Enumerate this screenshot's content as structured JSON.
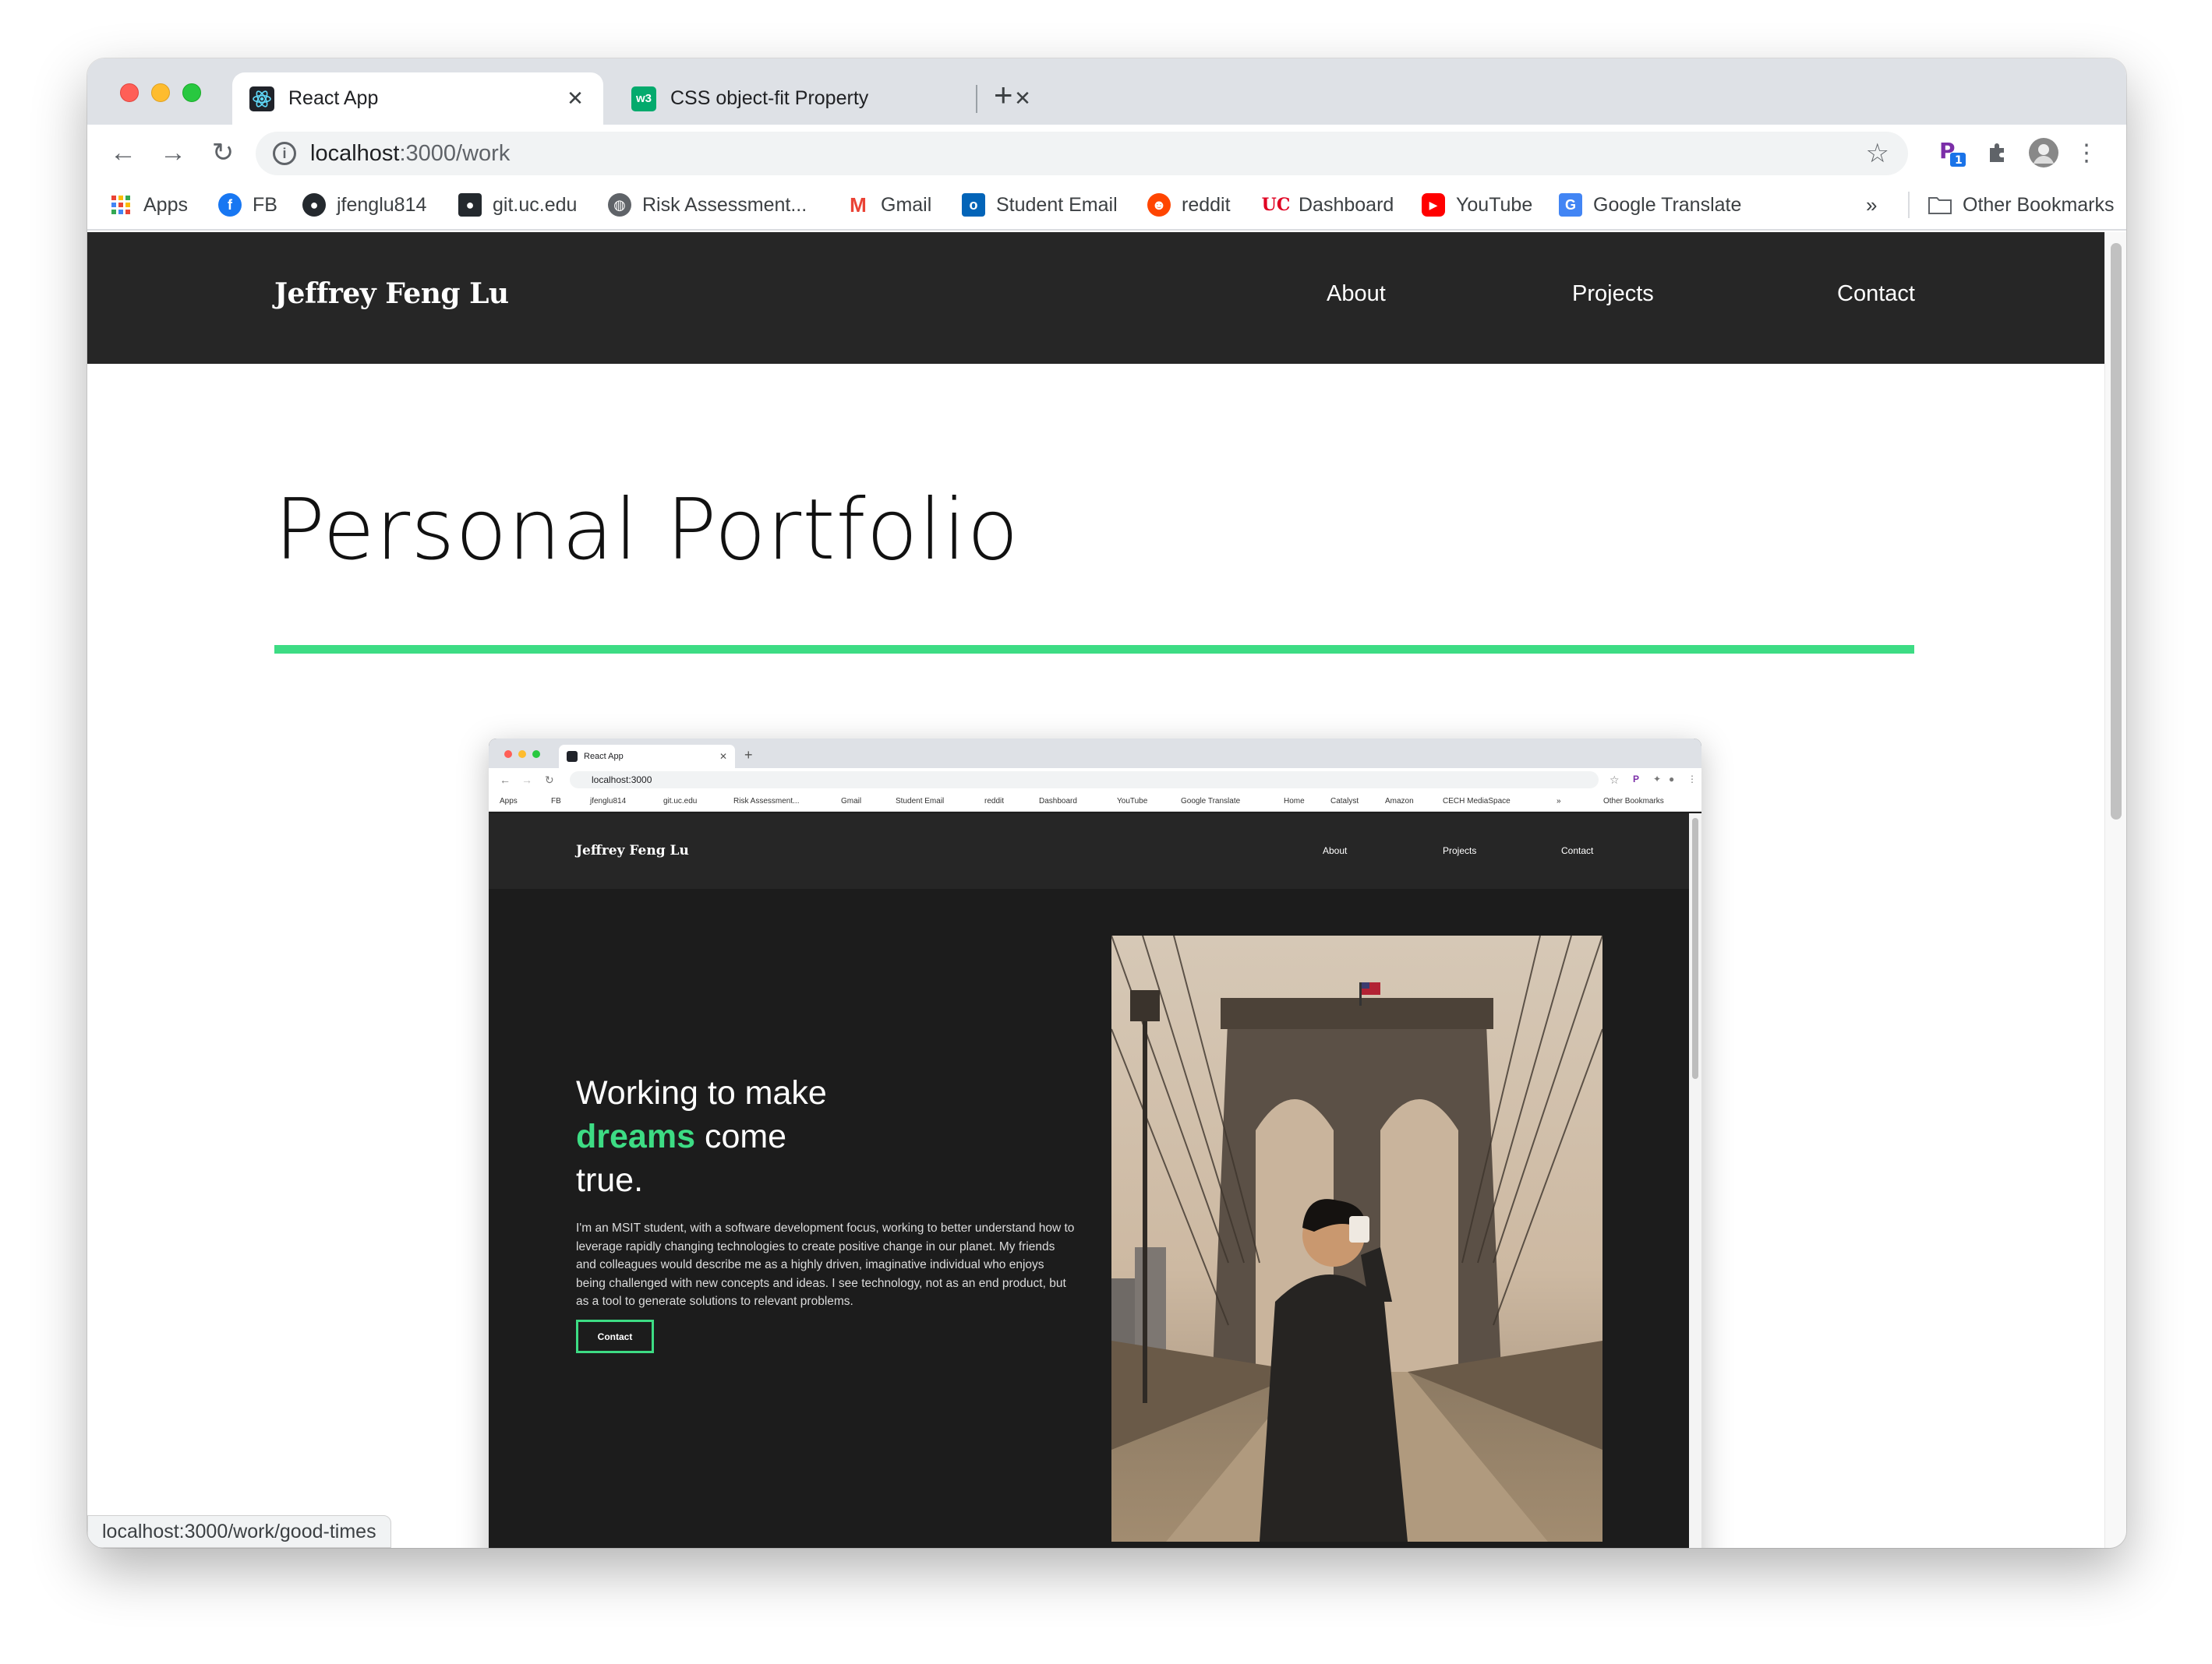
{
  "browser": {
    "tabs": [
      {
        "label": "React App",
        "active": true,
        "icon": "react-icon"
      },
      {
        "label": "CSS object-fit Property",
        "active": false,
        "icon": "w3schools-icon"
      }
    ],
    "url_host": "localhost",
    "url_path": ":3000/work",
    "bookmarks": [
      {
        "label": "Apps",
        "icon": "apps-grid-icon"
      },
      {
        "label": "FB",
        "icon": "facebook-icon"
      },
      {
        "label": "jfenglu814",
        "icon": "github-icon"
      },
      {
        "label": "git.uc.edu",
        "icon": "github-icon"
      },
      {
        "label": "Risk Assessment...",
        "icon": "globe-icon"
      },
      {
        "label": "Gmail",
        "icon": "gmail-icon"
      },
      {
        "label": "Student Email",
        "icon": "outlook-icon"
      },
      {
        "label": "reddit",
        "icon": "reddit-icon"
      },
      {
        "label": "Dashboard",
        "icon": "uc-icon"
      },
      {
        "label": "YouTube",
        "icon": "youtube-icon"
      },
      {
        "label": "Google Translate",
        "icon": "google-translate-icon"
      }
    ],
    "overflow_label": "»",
    "other_bookmarks": "Other Bookmarks",
    "status_url": "localhost:3000/work/good-times"
  },
  "site": {
    "brand": "Jeffrey Feng Lu",
    "nav": [
      "About",
      "Projects",
      "Contact"
    ],
    "page_title": "Personal Portfolio",
    "accent_color": "#3ddc84"
  },
  "preview": {
    "tab_label": "React App",
    "url": "localhost:3000",
    "bookmarks": [
      "Apps",
      "FB",
      "jfenglu814",
      "git.uc.edu",
      "Risk Assessment...",
      "Gmail",
      "Student Email",
      "reddit",
      "Dashboard",
      "YouTube",
      "Google Translate",
      "Home",
      "Catalyst",
      "Amazon",
      "CECH MediaSpace"
    ],
    "other_bookmarks": "Other Bookmarks",
    "brand": "Jeffrey Feng Lu",
    "nav": [
      "About",
      "Projects",
      "Contact"
    ],
    "headline_pre": "Working to make",
    "headline_accent": "dreams",
    "headline_mid": "come",
    "headline_post": "true.",
    "body": "I'm an MSIT student, with a software development focus, working to better understand how to leverage rapidly changing technologies to create positive change in our planet. My friends and colleagues would describe me as a highly driven, imaginative individual who enjoys being challenged with new concepts and ideas. I see technology, not as an end product, but as a tool to generate solutions to relevant problems.",
    "button": "Contact"
  }
}
